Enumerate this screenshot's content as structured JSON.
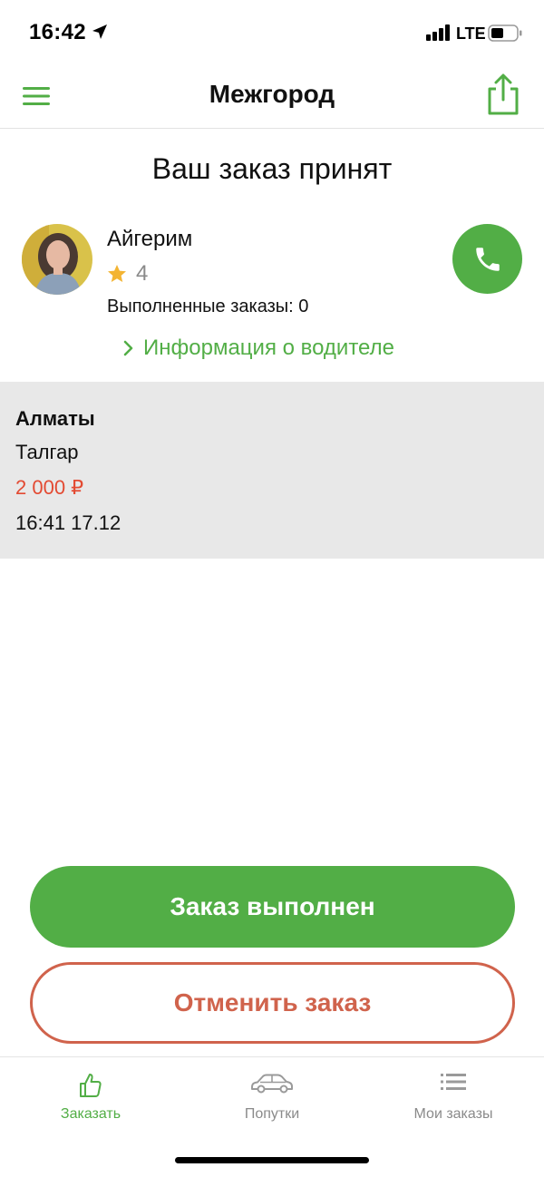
{
  "status_bar": {
    "time": "16:42",
    "network": "LTE"
  },
  "header": {
    "title": "Межгород",
    "menu_icon": "hamburger-menu-icon",
    "share_icon": "share-icon"
  },
  "order": {
    "status_title": "Ваш заказ принят"
  },
  "driver": {
    "name": "Айгерим",
    "rating": "4",
    "completed_orders": "Выполненные заказы: 0",
    "info_link": "Информация о водителе"
  },
  "route": {
    "from": "Алматы",
    "to": "Талгар",
    "price": "2 000 ₽",
    "datetime": "16:41 17.12"
  },
  "actions": {
    "complete_label": "Заказ выполнен",
    "cancel_label": "Отменить заказ"
  },
  "tabs": [
    {
      "label": "Заказать",
      "icon": "thumbs-up-icon",
      "active": true
    },
    {
      "label": "Попутки",
      "icon": "car-icon",
      "active": false
    },
    {
      "label": "Мои заказы",
      "icon": "list-icon",
      "active": false
    }
  ],
  "colors": {
    "accent": "#52ae46",
    "price": "#e34a32",
    "cancel": "#d0634c",
    "panel": "#e8e8e8",
    "inactive_tab": "#8a8a8a"
  }
}
